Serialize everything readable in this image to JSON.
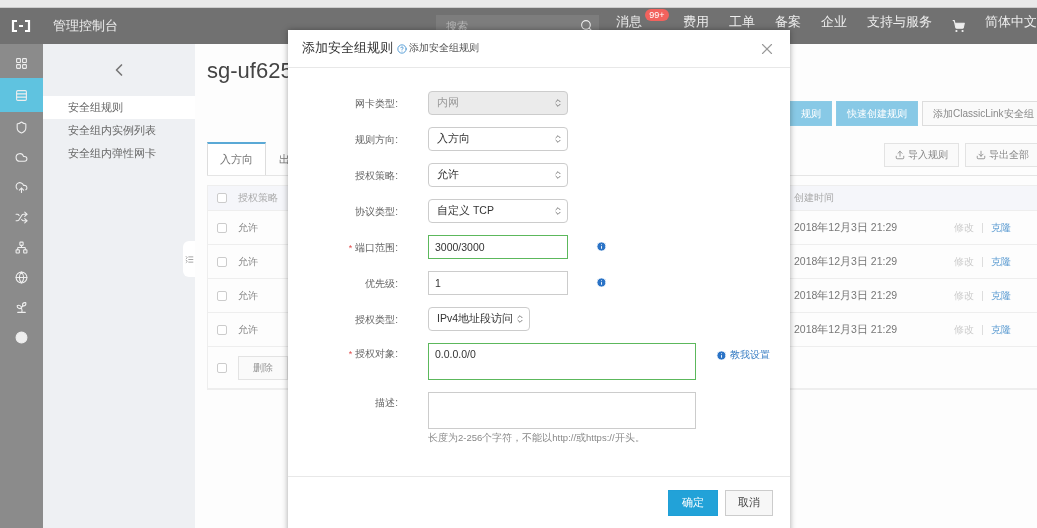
{
  "top_nav": {
    "title": "管理控制台",
    "search": {
      "placeholder": "搜索"
    },
    "items": [
      {
        "kind": "text",
        "label": "消息",
        "badge": "99+"
      },
      {
        "kind": "text",
        "label": "费用"
      },
      {
        "kind": "text",
        "label": "工单"
      },
      {
        "kind": "text",
        "label": "备案"
      },
      {
        "kind": "text",
        "label": "企业"
      },
      {
        "kind": "text",
        "label": "支持与服务"
      },
      {
        "kind": "cart"
      },
      {
        "kind": "text",
        "label": "简体中文"
      }
    ]
  },
  "rail": [
    {
      "selected": false
    },
    {
      "selected": true
    },
    {
      "selected": false
    },
    {
      "selected": false
    },
    {
      "selected": false
    },
    {
      "selected": false
    },
    {
      "selected": false
    },
    {
      "selected": false
    },
    {
      "selected": false
    },
    {
      "selected": false
    }
  ],
  "sidebar": {
    "items": [
      {
        "label": "安全组规则",
        "selected": true
      },
      {
        "label": "安全组内实例列表",
        "selected": false
      },
      {
        "label": "安全组内弹性网卡",
        "selected": false
      }
    ]
  },
  "page": {
    "title": "sg-uf625",
    "toolbar": [
      {
        "label": "规则",
        "primary": true
      },
      {
        "label": "快速创建规则",
        "primary": true
      },
      {
        "label": "添加ClassicLink安全组",
        "primary": false
      }
    ],
    "tabs": [
      {
        "label": "入方向",
        "selected": true
      },
      {
        "label": "出",
        "selected": false
      }
    ],
    "actions": [
      {
        "kind": "upload",
        "label": "导入规则"
      },
      {
        "kind": "download",
        "label": "导出全部"
      }
    ],
    "table": {
      "header_checked": false,
      "columns": [
        "授权策略",
        "",
        "创建时间",
        ""
      ],
      "rows": [
        {
          "checked": false,
          "policy": "允许",
          "created": "2018年12月3日 21:29",
          "actions": [
            {
              "label": "修改",
              "enabled": false
            },
            {
              "label": "克隆",
              "enabled": true
            }
          ]
        },
        {
          "checked": false,
          "policy": "允许",
          "created": "2018年12月3日 21:29",
          "actions": [
            {
              "label": "修改",
              "enabled": false
            },
            {
              "label": "克隆",
              "enabled": true
            }
          ]
        },
        {
          "checked": false,
          "policy": "允许",
          "created": "2018年12月3日 21:29",
          "actions": [
            {
              "label": "修改",
              "enabled": false
            },
            {
              "label": "克隆",
              "enabled": true
            }
          ]
        },
        {
          "checked": false,
          "policy": "允许",
          "created": "2018年12月3日 21:29",
          "actions": [
            {
              "label": "修改",
              "enabled": false
            },
            {
              "label": "克隆",
              "enabled": true
            }
          ]
        }
      ],
      "footer": {
        "checked": false,
        "button": "删除"
      }
    }
  },
  "dialog": {
    "title": "添加安全组规则",
    "help_link": "添加安全组规则",
    "fields": [
      {
        "kind": "select",
        "label": "网卡类型:",
        "value": "内网",
        "disabled": true
      },
      {
        "kind": "select",
        "label": "规则方向:",
        "value": "入方向",
        "disabled": false
      },
      {
        "kind": "select",
        "label": "授权策略:",
        "value": "允许",
        "disabled": false
      },
      {
        "kind": "select",
        "label": "协议类型:",
        "value": "自定义 TCP",
        "disabled": false
      },
      {
        "kind": "input",
        "label": "端口范围:",
        "value": "3000/3000",
        "required_mark": "*",
        "info": true,
        "valid": true
      },
      {
        "kind": "input",
        "label": "优先级:",
        "value": "1",
        "info": true,
        "valid": false
      },
      {
        "kind": "select",
        "label": "授权类型:",
        "value": "IPv4地址段访问",
        "disabled": false,
        "narrow": true
      },
      {
        "kind": "textarea",
        "label": "授权对象:",
        "value": "0.0.0.0/0",
        "required_mark": "*",
        "valid": true,
        "link": "教我设置"
      },
      {
        "kind": "textarea",
        "label": "描述:",
        "valid": false,
        "hint": "长度为2-256个字符，不能以http://或https://开头。"
      }
    ],
    "buttons": [
      {
        "label": "确定",
        "primary": true
      },
      {
        "label": "取消",
        "primary": false
      }
    ]
  }
}
